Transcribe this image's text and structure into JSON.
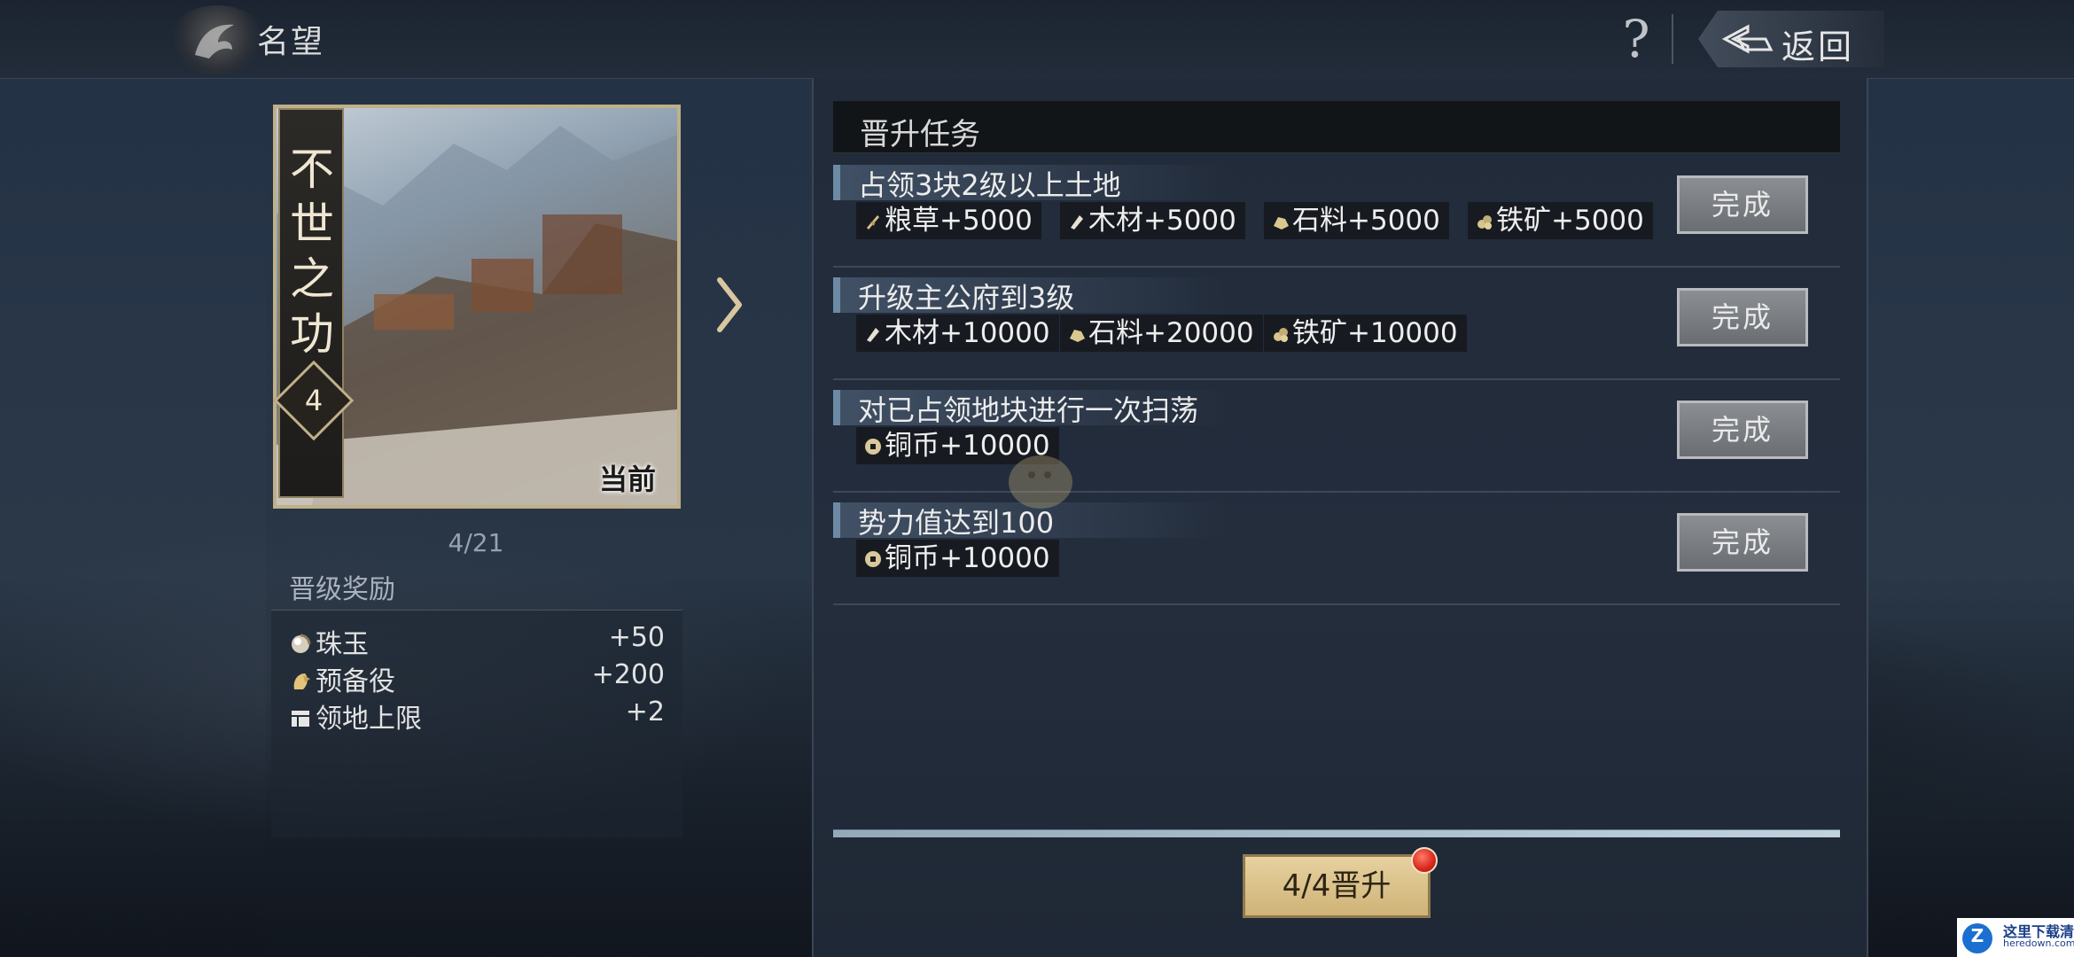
{
  "header": {
    "title": "名望",
    "help_label": "?",
    "back_label": "返回"
  },
  "card": {
    "name": "不世之功",
    "level": "4",
    "current_tag": "当前",
    "progress": "4/21"
  },
  "rewards": {
    "heading": "晋级奖励",
    "items": [
      {
        "icon": "pearl-icon",
        "label": "珠玉",
        "value": "+50"
      },
      {
        "icon": "reserve-troops-icon",
        "label": "预备役",
        "value": "+200"
      },
      {
        "icon": "territory-icon",
        "label": "领地上限",
        "value": "+2"
      }
    ]
  },
  "tasks": {
    "heading": "晋升任务",
    "done_label": "完成",
    "list": [
      {
        "title": "占领3块2级以上土地",
        "rewards": [
          {
            "icon": "grain-icon",
            "text": "粮草+5000"
          },
          {
            "icon": "wood-icon",
            "text": "木材+5000"
          },
          {
            "icon": "stone-icon",
            "text": "石料+5000"
          },
          {
            "icon": "iron-icon",
            "text": "铁矿+5000"
          }
        ]
      },
      {
        "title": "升级主公府到3级",
        "rewards": [
          {
            "icon": "wood-icon",
            "text": "木材+10000"
          },
          {
            "icon": "stone-icon",
            "text": "石料+20000"
          },
          {
            "icon": "iron-icon",
            "text": "铁矿+10000"
          }
        ]
      },
      {
        "title": "对已占领地块进行一次扫荡",
        "rewards": [
          {
            "icon": "copper-coin-icon",
            "text": "铜币+10000"
          }
        ]
      },
      {
        "title": "势力值达到100",
        "rewards": [
          {
            "icon": "copper-coin-icon",
            "text": "铜币+10000"
          }
        ]
      }
    ]
  },
  "promote": {
    "label": "4/4晋升",
    "progress_fraction": 1.0
  },
  "watermark": {
    "line1": "这里下载清",
    "line2": "heredown.com",
    "logo": "Z"
  },
  "colors": {
    "accent_gold": "#cfb377",
    "task_bar": "#6d8aa5",
    "notify_red": "#d8261a"
  }
}
